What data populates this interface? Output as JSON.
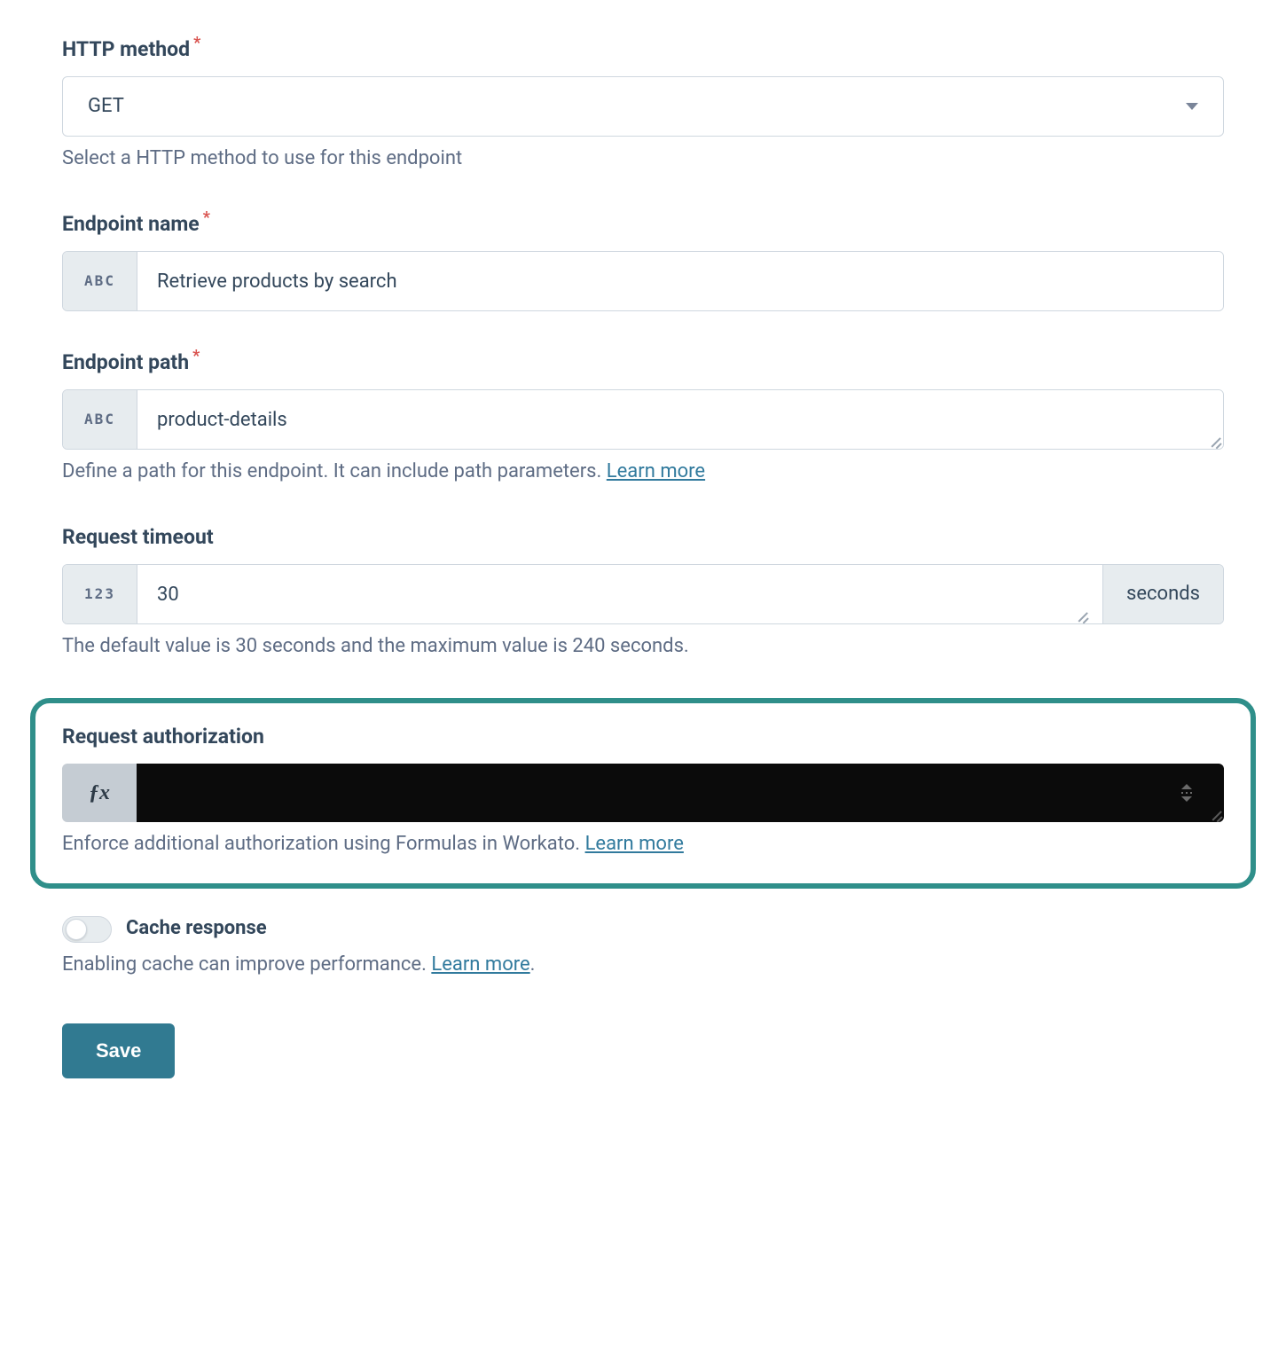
{
  "httpMethod": {
    "label": "HTTP method",
    "value": "GET",
    "helper": "Select a HTTP method to use for this endpoint"
  },
  "endpointName": {
    "label": "Endpoint name",
    "prefix": "ABC",
    "value": "Retrieve products by search"
  },
  "endpointPath": {
    "label": "Endpoint path",
    "prefix": "ABC",
    "value": "product-details",
    "helperPrefix": "Define a path for this endpoint. It can include path parameters. ",
    "helperLink": "Learn more"
  },
  "requestTimeout": {
    "label": "Request timeout",
    "prefix": "123",
    "value": "30",
    "suffix": "seconds",
    "helper": "The default value is 30 seconds and the maximum value is 240 seconds."
  },
  "requestAuth": {
    "label": "Request authorization",
    "prefix": "ƒx",
    "value": "",
    "helperPrefix": "Enforce additional authorization using Formulas in Workato. ",
    "helperLink": "Learn more"
  },
  "cacheResponse": {
    "label": "Cache response",
    "helperPrefix": "Enabling cache can improve performance. ",
    "helperLink": "Learn more",
    "helperSuffix": "."
  },
  "buttons": {
    "save": "Save"
  }
}
